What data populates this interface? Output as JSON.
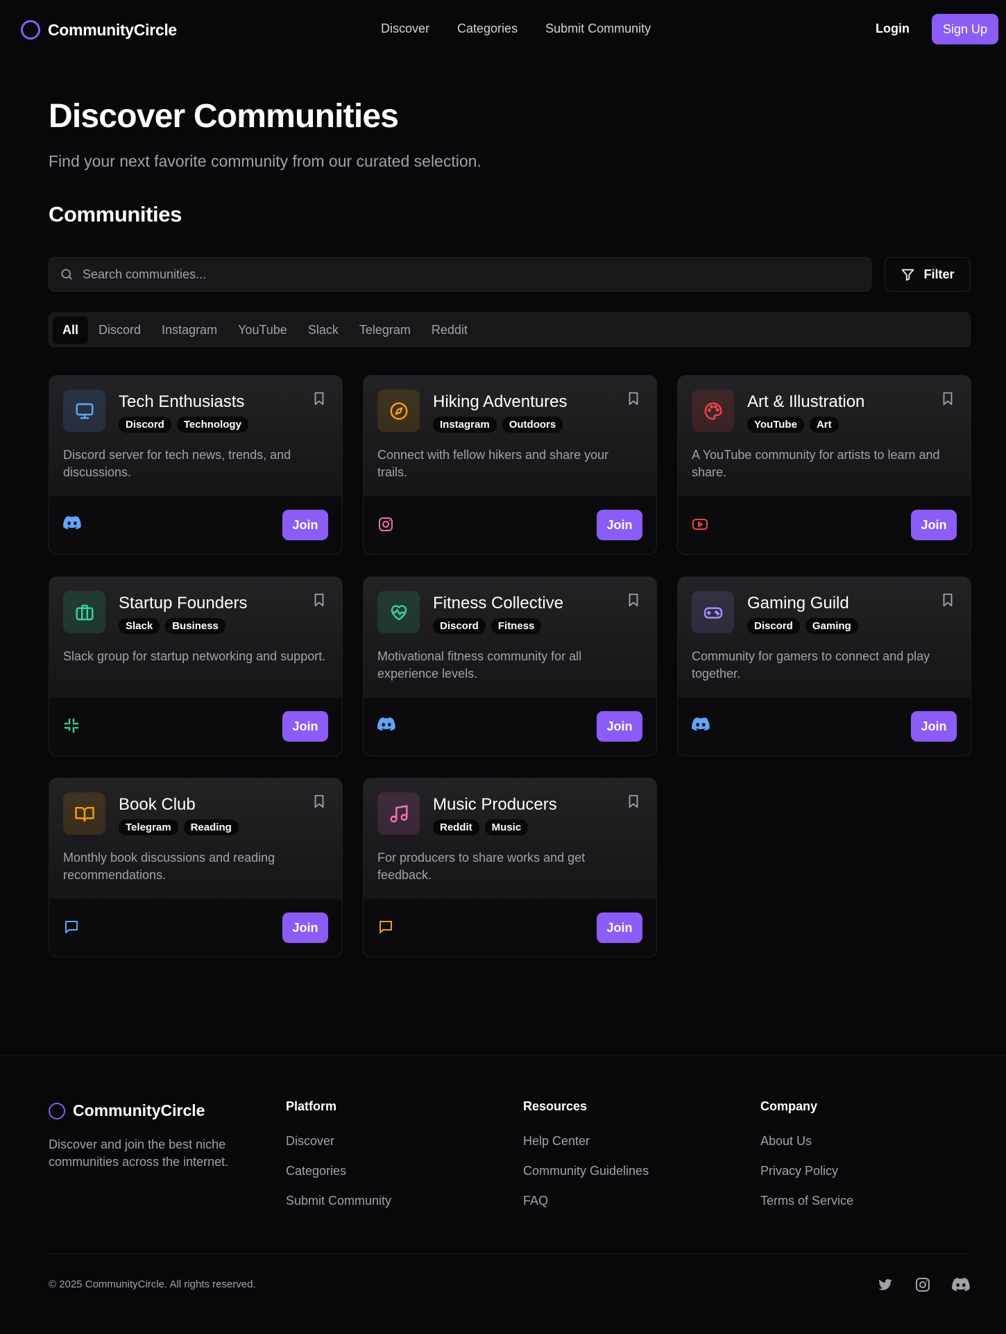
{
  "header": {
    "brand": "CommunityCircle",
    "nav": [
      "Discover",
      "Categories",
      "Submit Community"
    ],
    "login": "Login",
    "signup": "Sign Up"
  },
  "hero": {
    "title": "Discover Communities",
    "subtitle": "Find your next favorite community from our curated selection."
  },
  "section_title": "Communities",
  "search": {
    "placeholder": "Search communities...",
    "value": ""
  },
  "filter_label": "Filter",
  "tabs": [
    "All",
    "Discord",
    "Instagram",
    "YouTube",
    "Slack",
    "Telegram",
    "Reddit"
  ],
  "active_tab": "All",
  "join_label": "Join",
  "communities": [
    {
      "title": "Tech Enthusiasts",
      "tags": [
        "Discord",
        "Technology"
      ],
      "description": "Discord server for tech news, trends, and discussions.",
      "icon": "monitor-icon",
      "color": "#60a5fa",
      "platform_icon": "discord-icon"
    },
    {
      "title": "Hiking Adventures",
      "tags": [
        "Instagram",
        "Outdoors"
      ],
      "description": "Connect with fellow hikers and share your trails.",
      "icon": "compass-icon",
      "color": "#f59e0b",
      "platform_icon": "instagram-icon"
    },
    {
      "title": "Art & Illustration",
      "tags": [
        "YouTube",
        "Art"
      ],
      "description": "A YouTube community for artists to learn and share.",
      "icon": "palette-icon",
      "color": "#ef4444",
      "platform_icon": "youtube-icon"
    },
    {
      "title": "Startup Founders",
      "tags": [
        "Slack",
        "Business"
      ],
      "description": "Slack group for startup networking and support.",
      "icon": "briefcase-icon",
      "color": "#34d399",
      "platform_icon": "slack-icon"
    },
    {
      "title": "Fitness Collective",
      "tags": [
        "Discord",
        "Fitness"
      ],
      "description": "Motivational fitness community for all experience levels.",
      "icon": "heart-pulse-icon",
      "color": "#34d399",
      "platform_icon": "discord-icon"
    },
    {
      "title": "Gaming Guild",
      "tags": [
        "Discord",
        "Gaming"
      ],
      "description": "Community for gamers to connect and play together.",
      "icon": "gamepad-icon",
      "color": "#a78bfa",
      "platform_icon": "discord-icon"
    },
    {
      "title": "Book Club",
      "tags": [
        "Telegram",
        "Reading"
      ],
      "description": "Monthly book discussions and reading recommendations.",
      "icon": "book-icon",
      "color": "#f59e0b",
      "platform_icon": "telegram-icon"
    },
    {
      "title": "Music Producers",
      "tags": [
        "Reddit",
        "Music"
      ],
      "description": "For producers to share works and get feedback.",
      "icon": "music-icon",
      "color": "#f472b6",
      "platform_icon": "reddit-icon"
    }
  ],
  "footer": {
    "brand": "CommunityCircle",
    "description": "Discover and join the best niche communities across the internet.",
    "columns": [
      {
        "title": "Platform",
        "links": [
          "Discover",
          "Categories",
          "Submit Community"
        ]
      },
      {
        "title": "Resources",
        "links": [
          "Help Center",
          "Community Guidelines",
          "FAQ"
        ]
      },
      {
        "title": "Company",
        "links": [
          "About Us",
          "Privacy Policy",
          "Terms of Service"
        ]
      }
    ],
    "copyright": "© 2025 CommunityCircle. All rights reserved.",
    "socials": [
      "twitter-icon",
      "instagram-icon",
      "discord-icon"
    ]
  },
  "colors": {
    "accent": "#8b5cf6",
    "background": "#08080a"
  }
}
